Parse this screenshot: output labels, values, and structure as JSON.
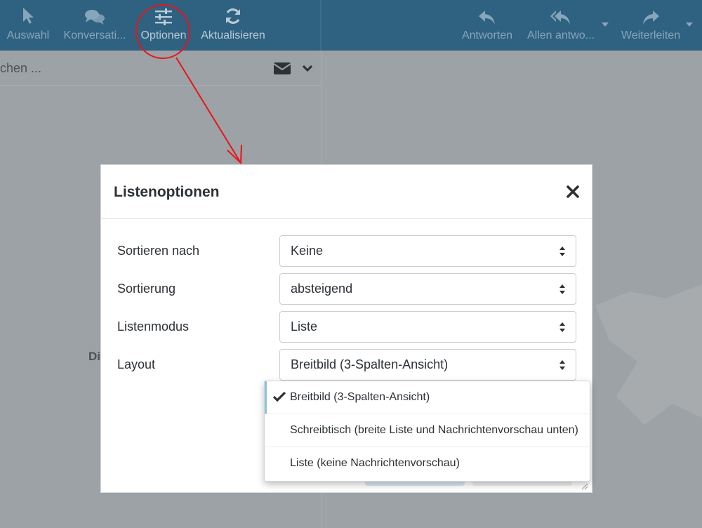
{
  "toolbar": {
    "select_label": "Auswahl",
    "conversation_label": "Konversati...",
    "options_label": "Optionen",
    "refresh_label": "Aktualisieren",
    "reply_label": "Antworten",
    "reply_all_label": "Allen antwo...",
    "forward_label": "Weiterleiten"
  },
  "list_header": {
    "search_text": "chen ..."
  },
  "list_body": {
    "partial_text": "Di"
  },
  "modal": {
    "title": "Listenoptionen",
    "fields": [
      {
        "label": "Sortieren nach",
        "value": "Keine"
      },
      {
        "label": "Sortierung",
        "value": "absteigend"
      },
      {
        "label": "Listenmodus",
        "value": "Liste"
      },
      {
        "label": "Layout",
        "value": "Breitbild (3-Spalten-Ansicht)"
      }
    ],
    "layout_options": [
      {
        "label": "Breitbild (3-Spalten-Ansicht)",
        "selected": true
      },
      {
        "label": "Schreibtisch (breite Liste und Nachrichtenvorschau unten)",
        "selected": false
      },
      {
        "label": "Liste (keine Nachrichtenvorschau)",
        "selected": false
      }
    ]
  },
  "colors": {
    "toolbar_bg": "#2f6180",
    "overlay": "#9da2a6",
    "annotation": "#e8141e",
    "selected_marker": "#8fc3de"
  }
}
